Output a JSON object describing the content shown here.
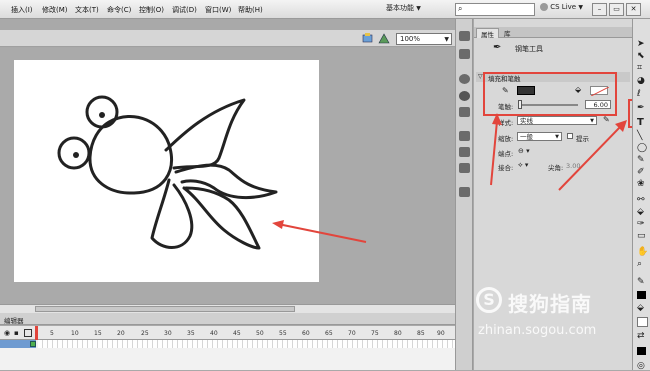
{
  "menubar": {
    "items": [
      "插入(I)",
      "修改(M)",
      "文本(T)",
      "命令(C)",
      "控制(O)",
      "调试(D)",
      "窗口(W)",
      "帮助(H)"
    ],
    "workspace_label": "基本功能",
    "cs_live_label": "CS Live"
  },
  "stage": {
    "zoom_value": "100%"
  },
  "timeline": {
    "panel_label": "编辑器",
    "frame_ticks": [
      "5",
      "10",
      "15",
      "20",
      "25",
      "30",
      "35",
      "40",
      "45",
      "50",
      "55",
      "60",
      "65",
      "70",
      "75",
      "80",
      "85",
      "90"
    ]
  },
  "properties": {
    "tabs": [
      "属性",
      "库"
    ],
    "tool_name": "钢笔工具",
    "section_title": "填充和笔触",
    "stroke_label": "笔触:",
    "stroke_value": "6.00",
    "style_label": "样式:",
    "style_value": "实线",
    "scale_label": "缩放:",
    "scale_value": "一般",
    "hint_label": "提示",
    "cap_label": "端点:",
    "join_label": "接合:",
    "miter_label": "尖角:",
    "miter_value": "3.00"
  },
  "watermark": {
    "brand": "搜狗指南",
    "url": "zhinan.sogou.com"
  },
  "colors": {
    "annotation_red": "#e2453c",
    "stroke_swatch": "#333333"
  }
}
